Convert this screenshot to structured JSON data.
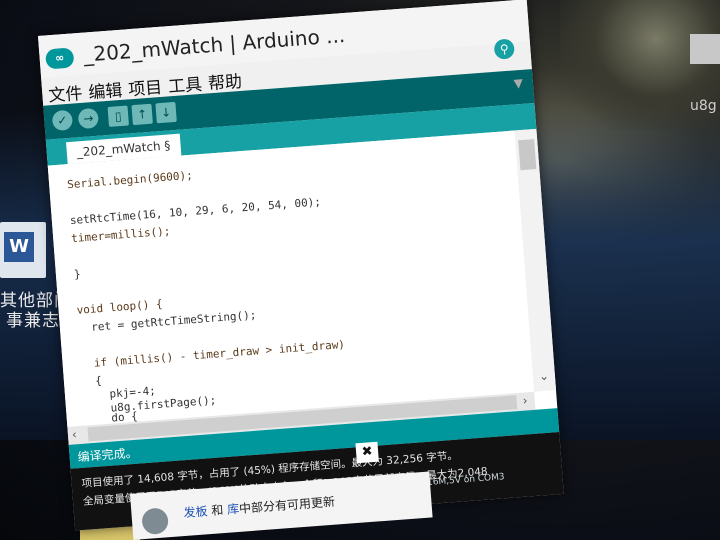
{
  "window": {
    "title": "_202_mWatch | Arduino ...",
    "logo": "∞"
  },
  "menu": [
    "文件",
    "编辑",
    "项目",
    "工具",
    "帮助"
  ],
  "toolbar": {
    "verify_icon": "✓",
    "upload_icon": "→",
    "new_icon": "▯",
    "open_icon": "↑",
    "save_icon": "↓",
    "search_icon": "⚲"
  },
  "tab": {
    "label": "_202_mWatch §",
    "menu_icon": "▼"
  },
  "code": [
    "Serial.begin(9600);",
    "",
    "setRtcTime(16, 10, 29, 6, 20, 54, 00);",
    "timer=millis();",
    "",
    "}",
    "",
    "void loop() {",
    "  ret = getRtcTimeString();",
    "",
    "  if (millis() - timer_draw > init_draw)",
    "  {",
    "    pkj=-4;",
    "    u8g.firstPage();",
    "    do {"
  ],
  "status": {
    "text": "编译完成。"
  },
  "console": {
    "line1": "项目使用了 14,608 字节，占用了 (45%) 程序存储空间。最大为 32,256 字节。",
    "line2": "全局变量使用了745字节，(36%)的动态内存，余留1,303字节局部变量。最大为2,048",
    "board": "328P @16M,5V on COM3"
  },
  "dialog": {
    "close_label": "✖"
  },
  "notification": {
    "prefix": "",
    "link1": "发板",
    "mid": "和",
    "link2": "库",
    "suffix": "中部分有可用更新"
  },
  "desktop": {
    "icon_letter": "W",
    "label_line1": "其他部门的",
    "label_line2": "事兼志愿",
    "right_label": "u8g"
  },
  "colors": {
    "teal_dark": "#006468",
    "teal": "#00979c",
    "teal_tab": "#17a1a5",
    "console_bg": "#111111",
    "keyword_orange": "#cc6600"
  }
}
